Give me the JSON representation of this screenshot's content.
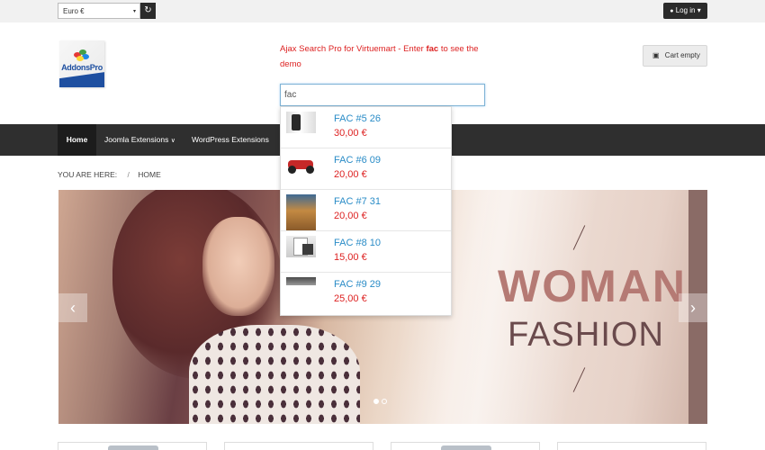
{
  "topbar": {
    "currency": "Euro €",
    "login_label": "Log in"
  },
  "header": {
    "logo_text": "AddonsPro",
    "promo_prefix": "Ajax Search Pro for Virtuemart - Enter ",
    "promo_keyword": "fac",
    "promo_suffix": " to see the demo",
    "cart_label": "Cart empty"
  },
  "search": {
    "value": "fac",
    "results": [
      {
        "name": "FAC #5 26",
        "price": "30,00 €",
        "thumb": "shirt-thumbnail"
      },
      {
        "name": "FAC #6 09",
        "price": "20,00 €",
        "thumb": "motorcycle-thumbnail"
      },
      {
        "name": "FAC #7 31",
        "price": "20,00 €",
        "thumb": "photo-thumbnail"
      },
      {
        "name": "FAC #8 10",
        "price": "15,00 €",
        "thumb": "document-thumbnail"
      },
      {
        "name": "FAC #9 29",
        "price": "25,00 €",
        "thumb": "image-thumbnail"
      }
    ]
  },
  "nav": {
    "items": [
      {
        "label": "Home",
        "active": true
      },
      {
        "label": "Joomla Extensions",
        "has_dropdown": true
      },
      {
        "label": "WordPress Extensions"
      }
    ]
  },
  "breadcrumb": {
    "prefix": "YOU ARE HERE:",
    "separator": "/",
    "current": "HOME"
  },
  "banner": {
    "headline": "WOMAN",
    "subheadline": "FASHION",
    "slide_count": 2,
    "active_slide": 1
  },
  "icons": {
    "refresh": "↻",
    "user": "👤",
    "caret_down": "▾",
    "cart": "🛒",
    "arrow_left": "‹",
    "arrow_right": "›"
  },
  "colors": {
    "accent_red": "#dd2222",
    "link_blue": "#2a8cc7",
    "nav_bg": "#2f2f2f"
  }
}
